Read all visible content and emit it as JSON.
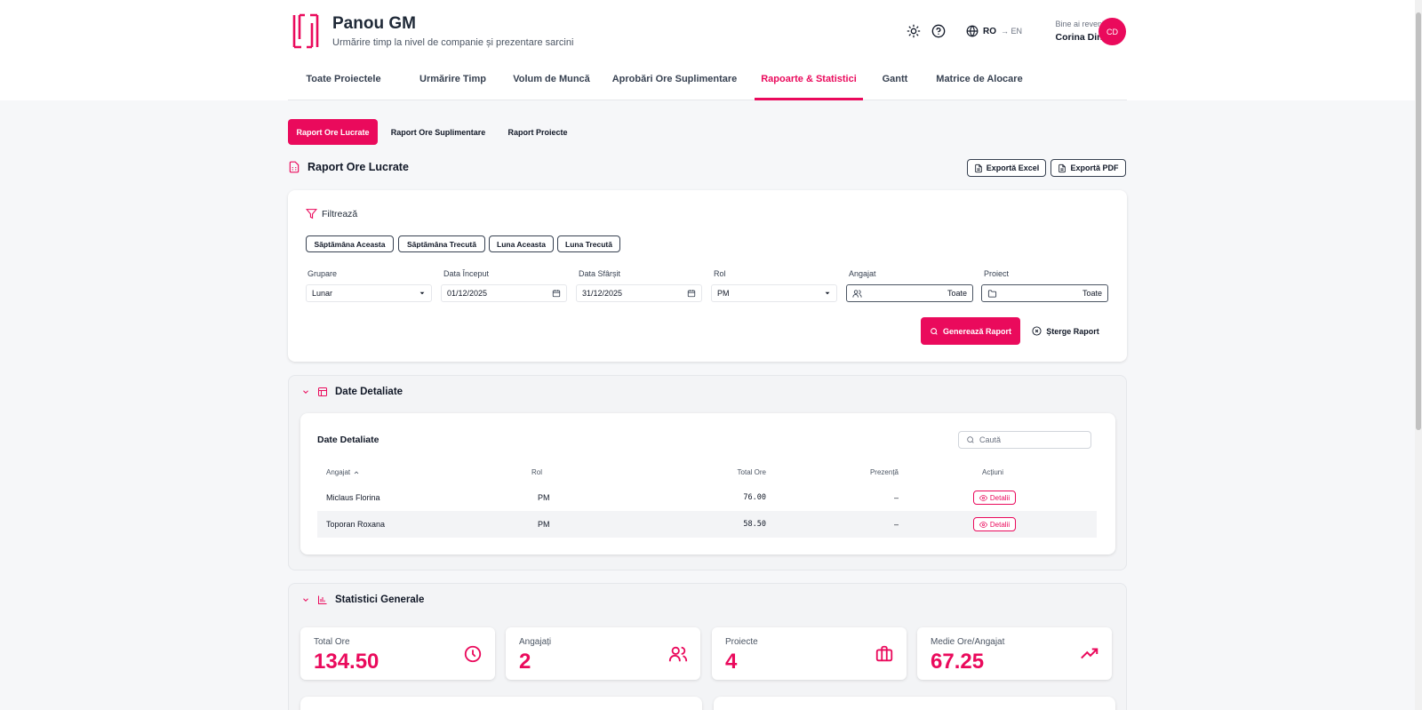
{
  "header": {
    "title": "Panou GM",
    "subtitle": "Urmărire timp la nivel de companie și prezentare sarcini",
    "lang_current": "RO",
    "lang_switch": "→ EN",
    "welcome": "Bine ai revenit,",
    "user_name": "Corina Dinu",
    "avatar_initials": "CD"
  },
  "nav": {
    "tabs": [
      {
        "label": "Toate Proiectele"
      },
      {
        "label": "Urmărire Timp"
      },
      {
        "label": "Volum de Muncă"
      },
      {
        "label": "Aprobări Ore Suplimentare"
      },
      {
        "label": "Rapoarte & Statistici",
        "active": true
      },
      {
        "label": "Gantt"
      },
      {
        "label": "Matrice de Alocare"
      }
    ]
  },
  "subtabs": [
    {
      "label": "Raport Ore Lucrate",
      "active": true
    },
    {
      "label": "Raport Ore Suplimentare"
    },
    {
      "label": "Raport Proiecte"
    }
  ],
  "report": {
    "title": "Raport Ore Lucrate",
    "export_excel": "Exportă Excel",
    "export_pdf": "Exportă PDF"
  },
  "filters": {
    "title": "Filtrează",
    "presets": [
      "Săptămâna Aceasta",
      "Săptămâna Trecută",
      "Luna Aceasta",
      "Luna Trecută"
    ],
    "grouping": {
      "label": "Grupare",
      "value": "Lunar"
    },
    "start_date": {
      "label": "Data Început",
      "value": "01/12/2025"
    },
    "end_date": {
      "label": "Data Sfârșit",
      "value": "31/12/2025"
    },
    "role": {
      "label": "Rol",
      "value": "PM"
    },
    "employee": {
      "label": "Angajat",
      "value": "Toate"
    },
    "project": {
      "label": "Proiect",
      "value": "Toate"
    },
    "generate": "Generează Raport",
    "clear": "Șterge Raport"
  },
  "details": {
    "section_title": "Date Detaliate",
    "card_title": "Date Detaliate",
    "search_placeholder": "Caută",
    "columns": [
      "Angajat",
      "Rol",
      "Total Ore",
      "Prezență",
      "Acțiuni"
    ],
    "rows": [
      {
        "name": "Miclaus Florina",
        "role": "PM",
        "total": "76.00",
        "presence": "–",
        "action": "Detalii"
      },
      {
        "name": "Toporan Roxana",
        "role": "PM",
        "total": "58.50",
        "presence": "–",
        "action": "Detalii"
      }
    ]
  },
  "stats": {
    "section_title": "Statistici Generale",
    "cards": [
      {
        "label": "Total Ore",
        "value": "134.50",
        "icon": "clock-icon"
      },
      {
        "label": "Angajați",
        "value": "2",
        "icon": "users-icon"
      },
      {
        "label": "Proiecte",
        "value": "4",
        "icon": "briefcase-icon"
      },
      {
        "label": "Medie Ore/Angajat",
        "value": "67.25",
        "icon": "trending-up-icon"
      }
    ]
  },
  "colors": {
    "accent": "#ea0a5c",
    "text": "#111827",
    "muted": "#6b7280",
    "background": "#f6f7f9"
  }
}
